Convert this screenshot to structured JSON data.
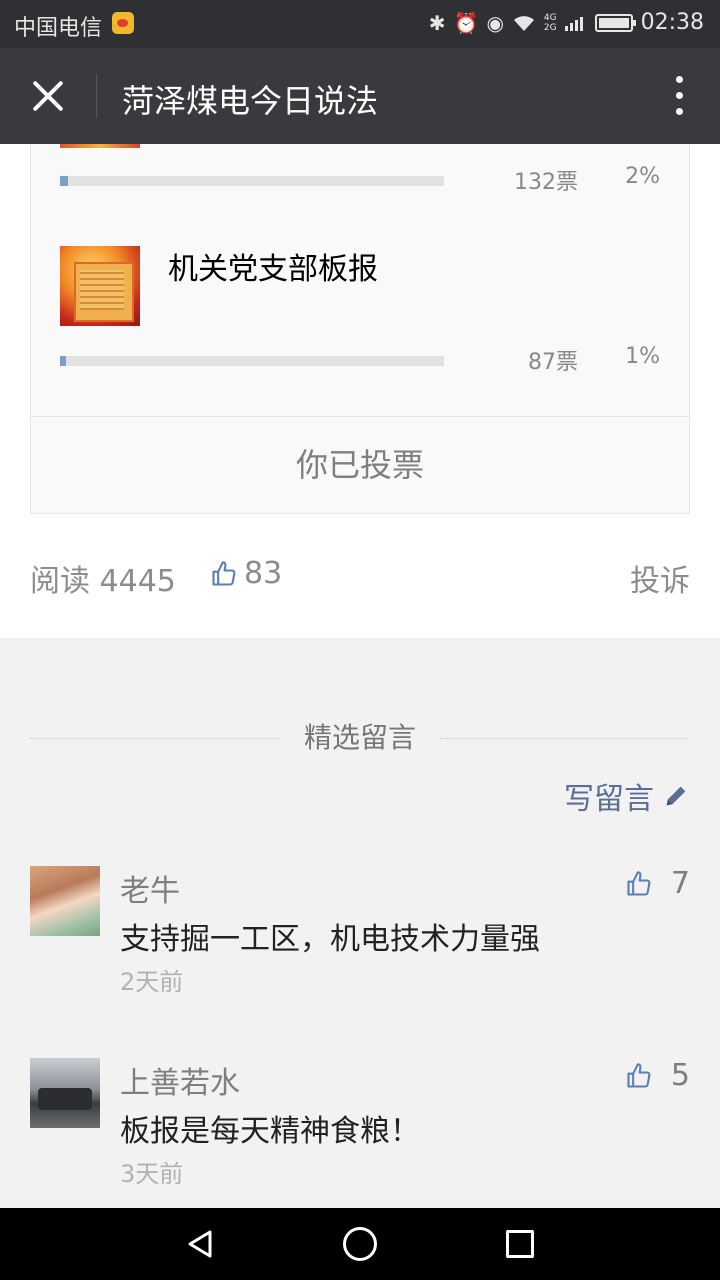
{
  "status_bar": {
    "carrier": "中国电信",
    "network_top": "4G",
    "network_bottom": "2G",
    "time": "02:38"
  },
  "nav": {
    "title": "菏泽煤电今日说法"
  },
  "poll": {
    "options": [
      {
        "title": "",
        "votes": "132票",
        "percent": "2%",
        "fill": 0.02
      },
      {
        "title": "机关党支部板报",
        "votes": "87票",
        "percent": "1%",
        "fill": 0.01
      }
    ],
    "voted_label": "你已投票"
  },
  "article_meta": {
    "read_label": "阅读 4445",
    "likes": "83",
    "report_label": "投诉"
  },
  "comments_section": {
    "title": "精选留言",
    "write_label": "写留言"
  },
  "comments": [
    {
      "nickname": "老牛",
      "text": "支持掘一工区，机电技术力量强",
      "time": "2天前",
      "likes": "7"
    },
    {
      "nickname": "上善若水",
      "text": "板报是每天精神食粮！",
      "time": "3天前",
      "likes": "5"
    }
  ],
  "colors": {
    "nav_bg": "#383a3d",
    "status_bg": "#2f3033",
    "link_blue": "#5a6f94",
    "bar_fill": "#7b9ecb"
  }
}
